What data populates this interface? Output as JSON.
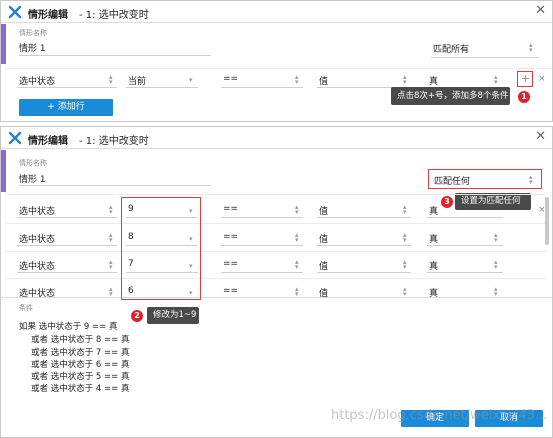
{
  "top_dialog": {
    "title": "情形编辑",
    "subtitle": "-   1: 选中改变时",
    "name_label": "情形名称",
    "name_value": "情形 1",
    "match_value": "匹配所有",
    "row": {
      "field": "选中状态",
      "value": "当前",
      "operator": "==",
      "type": "值",
      "result": "真"
    },
    "add_row_label": "+ 添加行",
    "plus_symbol": "+",
    "remove_symbol": "×",
    "callout": "点击8次+号，添加多8个条件",
    "badge": "1"
  },
  "bottom_dialog": {
    "title": "情形编辑",
    "subtitle": "-   1: 选中改变时",
    "name_label": "情形名称",
    "name_value": "情形 1",
    "match_value": "匹配任何",
    "callout_match": "设置为匹配任何",
    "badge_match": "3",
    "callout_values": "修改为1~9",
    "badge_values": "2",
    "remove_symbol": "×",
    "rows": [
      {
        "field": "选中状态",
        "value": "9",
        "operator": "==",
        "type": "值",
        "result": "真"
      },
      {
        "field": "选中状态",
        "value": "8",
        "operator": "==",
        "type": "值",
        "result": "真"
      },
      {
        "field": "选中状态",
        "value": "7",
        "operator": "==",
        "type": "值",
        "result": "真"
      },
      {
        "field": "选中状态",
        "value": "6",
        "operator": "==",
        "type": "值",
        "result": "真"
      }
    ],
    "condition_label": "条件",
    "conditions": [
      "如果  选中状态于 9 == 真",
      "或者  选中状态于 8 == 真",
      "或者  选中状态于 7 == 真",
      "或者  选中状态于 6 == 真",
      "或者  选中状态于 5 == 真",
      "或者  选中状态于 4 == 真"
    ],
    "ok_label": "确定",
    "cancel_label": "取消",
    "watermark": "https://blog.csdn.net/weixin_43..."
  },
  "colors": {
    "accent": "#8a6ccf",
    "primary": "#1a8bd8",
    "annotation": "#e23b3b",
    "callout_bg": "#4a4a4a"
  }
}
